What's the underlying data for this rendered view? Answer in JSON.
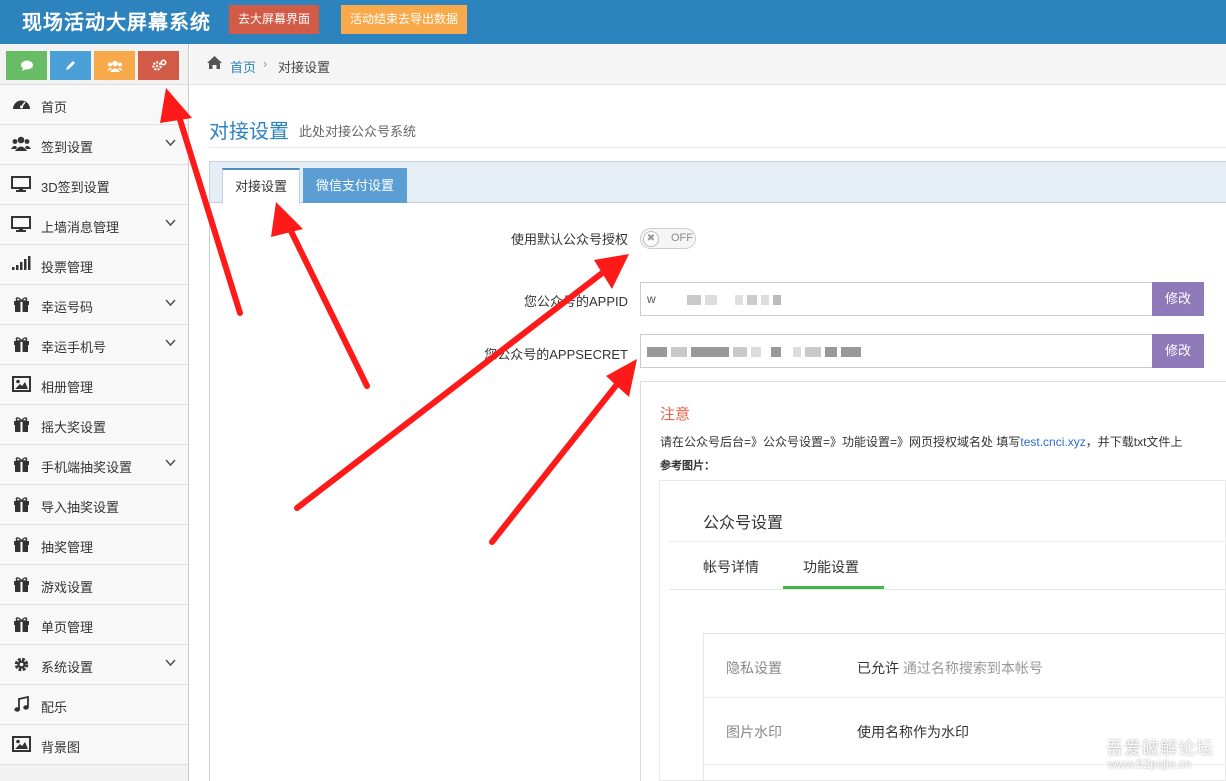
{
  "app": {
    "title": "现场活动大屏幕系统"
  },
  "topbar": {
    "btn_screen": "去大屏幕界面",
    "btn_export": "活动结束去导出数据"
  },
  "shortcuts": [
    "comment-icon",
    "pencil-icon",
    "users-icon",
    "cogs-icon"
  ],
  "sidebar": {
    "items": [
      {
        "label": "首页",
        "icon": "dashboard-icon",
        "has_sub": false
      },
      {
        "label": "签到设置",
        "icon": "users-icon",
        "has_sub": true
      },
      {
        "label": "3D签到设置",
        "icon": "desktop-icon",
        "has_sub": false
      },
      {
        "label": "上墙消息管理",
        "icon": "desktop-icon",
        "has_sub": true
      },
      {
        "label": "投票管理",
        "icon": "signal-icon",
        "has_sub": false
      },
      {
        "label": "幸运号码",
        "icon": "gift-icon",
        "has_sub": true
      },
      {
        "label": "幸运手机号",
        "icon": "gift-icon",
        "has_sub": true
      },
      {
        "label": "相册管理",
        "icon": "picture-icon",
        "has_sub": false
      },
      {
        "label": "摇大奖设置",
        "icon": "gift-icon",
        "has_sub": false
      },
      {
        "label": "手机端抽奖设置",
        "icon": "gift-icon",
        "has_sub": true
      },
      {
        "label": "导入抽奖设置",
        "icon": "gift-icon",
        "has_sub": false
      },
      {
        "label": "抽奖管理",
        "icon": "gift-icon",
        "has_sub": false
      },
      {
        "label": "游戏设置",
        "icon": "gift-icon",
        "has_sub": false
      },
      {
        "label": "单页管理",
        "icon": "gift-icon",
        "has_sub": false
      },
      {
        "label": "系统设置",
        "icon": "gear-icon",
        "has_sub": true
      },
      {
        "label": "配乐",
        "icon": "music-icon",
        "has_sub": false
      },
      {
        "label": "背景图",
        "icon": "picture-icon",
        "has_sub": false
      }
    ]
  },
  "breadcrumb": {
    "home": "首页",
    "separator": "›",
    "current": "对接设置"
  },
  "page": {
    "title": "对接设置",
    "subtitle": "此处对接公众号系统"
  },
  "tabs": [
    {
      "label": "对接设置",
      "active": true
    },
    {
      "label": "微信支付设置",
      "active": false
    }
  ],
  "form": {
    "default_auth_label": "使用默认公众号授权",
    "default_auth_toggle": "OFF",
    "appid_label": "您公众号的APPID",
    "appid_value": "w",
    "appsecret_label": "您公众号的APPSECRET",
    "edit_label": "修改"
  },
  "note": {
    "title": "注意",
    "text_before": "请在公众号后台=》公众号设置=》功能设置=》网页授权域名处 填写",
    "link": "test.cnci.xyz",
    "text_after": "，并下载txt文件上",
    "ref_label": "参考图片："
  },
  "ref_image": {
    "title": "公众号设置",
    "tab1": "帐号详情",
    "tab2": "功能设置",
    "row1_key": "隐私设置",
    "row1_value": "已允许",
    "row1_desc": "通过名称搜索到本帐号",
    "row2_key": "图片水印",
    "row2_value": "使用名称作为水印"
  },
  "watermark": {
    "line1": "吾爱破解论坛",
    "line2": "www.52pojie.cn"
  },
  "colors": {
    "topbar": "#2d83bd",
    "accent_red": "#d15b47",
    "accent_orange": "#f8a94a",
    "edit_button": "#8e7ab8",
    "arrow": "#ff1a1a"
  }
}
